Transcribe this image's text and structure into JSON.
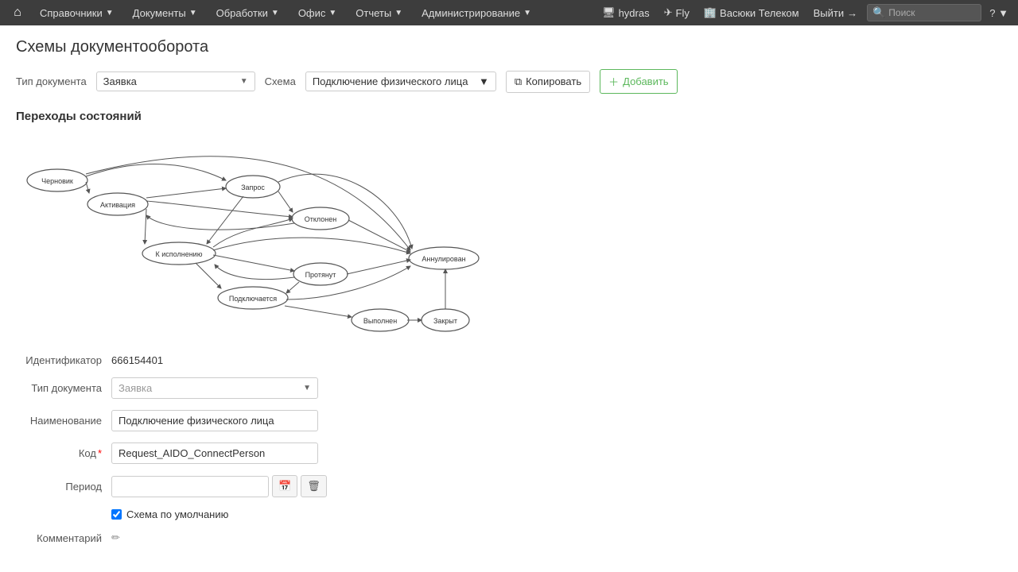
{
  "nav": {
    "home_icon": "⌂",
    "items": [
      {
        "label": "Справочники",
        "has_arrow": true
      },
      {
        "label": "Документы",
        "has_arrow": true
      },
      {
        "label": "Обработки",
        "has_arrow": true
      },
      {
        "label": "Офис",
        "has_arrow": true
      },
      {
        "label": "Отчеты",
        "has_arrow": true
      },
      {
        "label": "Администрирование",
        "has_arrow": true
      }
    ],
    "right_items": [
      {
        "icon": "🖥",
        "label": "hydras"
      },
      {
        "icon": "✈",
        "label": "Fly"
      },
      {
        "icon": "🏢",
        "label": "Васюки Телеком"
      }
    ],
    "logout_label": "Выйти",
    "search_placeholder": "Поиск",
    "help_icon": "?"
  },
  "page": {
    "title": "Схемы документооборота",
    "doc_type_label": "Тип документа",
    "doc_type_value": "Заявка",
    "schema_label": "Схема",
    "schema_value": "Подключение физического лица",
    "copy_btn": "Копировать",
    "add_btn": "Добавить",
    "section_transitions": "Переходы состояний",
    "form": {
      "identifier_label": "Идентификатор",
      "identifier_value": "666154401",
      "doc_type_label": "Тип документа",
      "doc_type_placeholder": "Заявка",
      "name_label": "Наименование",
      "name_value": "Подключение физического лица",
      "code_label": "Код",
      "code_value": "Request_AIDO_ConnectPerson",
      "period_label": "Период",
      "period_value": "",
      "default_schema_label": "Схема по умолчанию",
      "default_schema_checked": true,
      "comment_label": "Комментарий"
    }
  }
}
